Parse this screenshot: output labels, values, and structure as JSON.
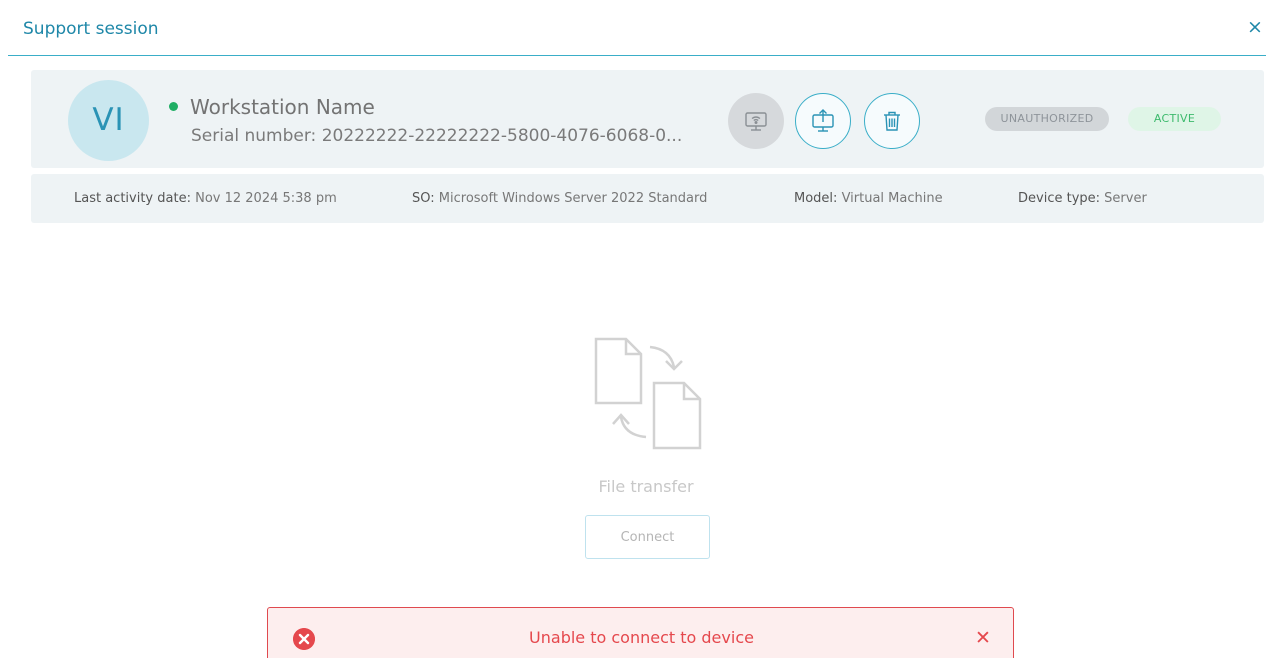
{
  "dialog": {
    "title": "Support session",
    "close_symbol": "×",
    "accent_color": "#1e87a8"
  },
  "device": {
    "avatar_initials": "VI",
    "status": "online",
    "status_color": "#1fae64",
    "name": "Workstation Name",
    "serial": "Serial number: 20222222-22222222-5800-4076-6068-0...",
    "actions": [
      {
        "icon": "remote-desktop-icon",
        "state": "disabled"
      },
      {
        "icon": "file-transfer-icon",
        "state": "enabled"
      },
      {
        "icon": "trash-icon",
        "state": "enabled"
      }
    ],
    "badges": {
      "authorization": "UNAUTHORIZED",
      "activity": "ACTIVE"
    }
  },
  "info": {
    "last_activity_label": "Last activity date:",
    "last_activity_value": "Nov 12 2024 5:38 pm",
    "os_label": "SO:",
    "os_value": "Microsoft Windows Server 2022 Standard",
    "model_label": "Model:",
    "model_value": "Virtual Machine",
    "device_type_label": "Device type:",
    "device_type_value": "Server"
  },
  "file_transfer": {
    "icon": "file-transfer-icon",
    "label": "File transfer",
    "connect_label": "Connect"
  },
  "notification": {
    "icon": "error-icon",
    "message": "Unable to connect to device",
    "close_symbol": "✕",
    "color": "#e5484d"
  }
}
